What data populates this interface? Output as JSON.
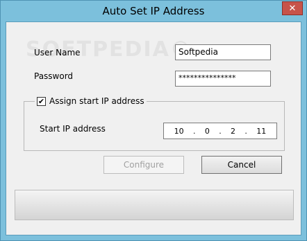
{
  "window": {
    "title": "Auto Set IP Address",
    "close_label": "✕"
  },
  "watermark": "SOFTPEDIA®",
  "form": {
    "username_label": "User Name",
    "username_value": "Softpedia",
    "password_label": "Password",
    "password_value": "***************",
    "assign_ip": {
      "label": "Assign start IP address",
      "checked": true,
      "check_mark": "✔",
      "start_ip_label": "Start IP address",
      "octets": [
        "10",
        "0",
        "2",
        "11"
      ]
    }
  },
  "buttons": {
    "configure_label": "Configure",
    "cancel_label": "Cancel"
  },
  "progress": {
    "value": 0
  },
  "colors": {
    "title_bar": "#7cc0dc",
    "close_button": "#c7534a",
    "client_background": "#f0f0f0"
  }
}
